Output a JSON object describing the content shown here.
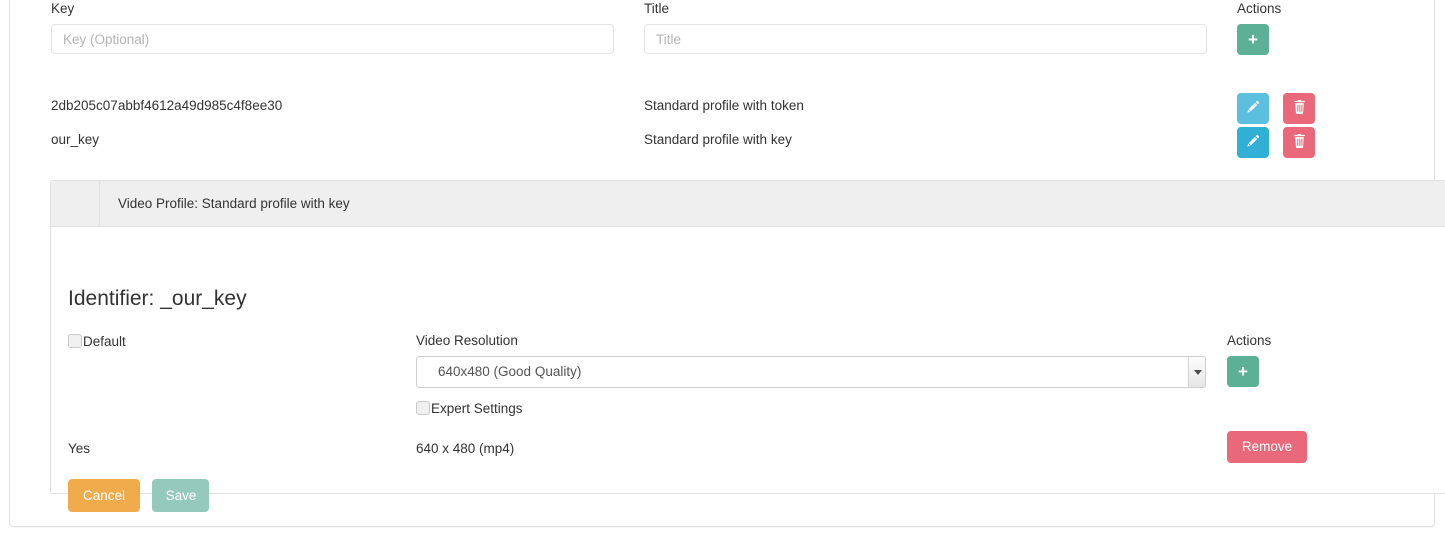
{
  "profiles_table": {
    "columns": {
      "key_label": "Key",
      "title_label": "Title",
      "actions_label": "Actions"
    },
    "new_row": {
      "key_placeholder": "Key (Optional)",
      "key_value": "",
      "title_placeholder": "Title",
      "title_value": "",
      "add_icon": "plus-icon"
    },
    "rows": [
      {
        "key": "2db205c07abbf4612a49d985c4f8ee30",
        "title": "Standard profile with token",
        "edit_icon": "pencil-icon",
        "delete_icon": "trash-icon"
      },
      {
        "key": "our_key",
        "title": "Standard profile with key",
        "edit_icon": "pencil-icon",
        "delete_icon": "trash-icon"
      }
    ]
  },
  "detail_panel": {
    "header_title": "Video Profile: Standard profile with key",
    "identifier": "Identifier: _our_key",
    "default": {
      "label": "Default",
      "checked": false
    },
    "video_resolution": {
      "label": "Video Resolution",
      "selected": "640x480 (Good Quality)",
      "options": [
        "640x480 (Good Quality)"
      ]
    },
    "expert_settings": {
      "label": "Expert Settings",
      "checked": false
    },
    "actions_label": "Actions",
    "add_icon": "plus-icon",
    "existing_row": {
      "default_value": "Yes",
      "resolution_value": "640 x 480 (mp4)",
      "remove_label": "Remove"
    },
    "footer": {
      "cancel_label": "Cancel",
      "save_label": "Save"
    }
  },
  "colors": {
    "green": "#5cb096",
    "blue": "#5bc0de",
    "blue_active": "#31b0d5",
    "red": "#e9697a",
    "orange": "#efab4c",
    "save_disabled": "#95c9bc",
    "panel_header_bg": "#efefef"
  }
}
